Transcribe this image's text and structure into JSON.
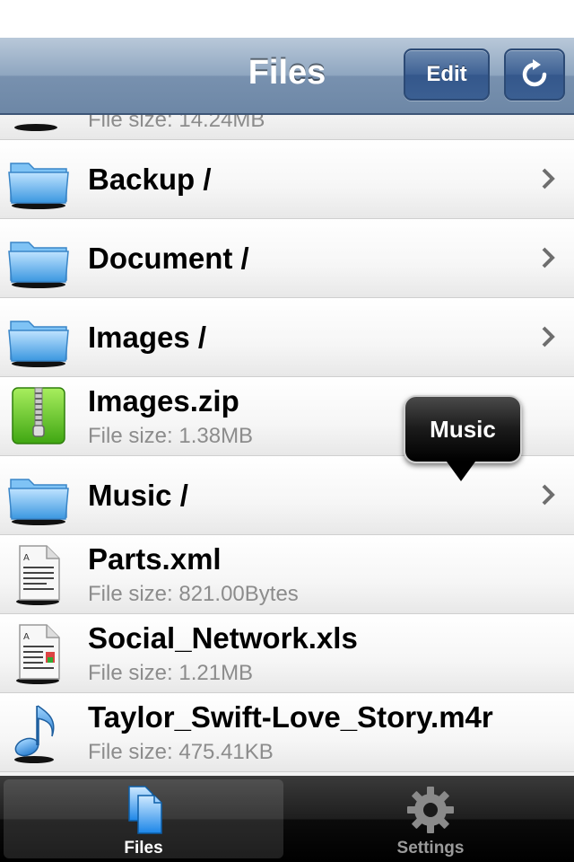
{
  "navbar": {
    "title": "Files",
    "edit_label": "Edit",
    "refresh_icon": "refresh-icon"
  },
  "list": {
    "partial_top": {
      "size": "File size: 14.24MB"
    },
    "items": [
      {
        "name": "Backup /",
        "kind": "folder"
      },
      {
        "name": "Document /",
        "kind": "folder"
      },
      {
        "name": "Images /",
        "kind": "folder"
      },
      {
        "name": "Images.zip",
        "kind": "zip",
        "size": "File size: 1.38MB"
      },
      {
        "name": "Music /",
        "kind": "folder"
      },
      {
        "name": "Parts.xml",
        "kind": "document",
        "size": "File size: 821.00Bytes"
      },
      {
        "name": "Social_Network.xls",
        "kind": "document",
        "size": "File size: 1.21MB"
      },
      {
        "name": "Taylor_Swift-Love_Story.m4r",
        "kind": "audio",
        "size": "File size: 475.41KB"
      }
    ]
  },
  "tooltip": {
    "label": "Music"
  },
  "tabbar": {
    "tabs": [
      {
        "label": "Files",
        "selected": true
      },
      {
        "label": "Settings",
        "selected": false
      }
    ]
  },
  "colors": {
    "navbar": "#7891af",
    "folder_blue": "#5aaeea",
    "zip_green": "#5cc52a",
    "size_text": "#8c8c8c"
  }
}
